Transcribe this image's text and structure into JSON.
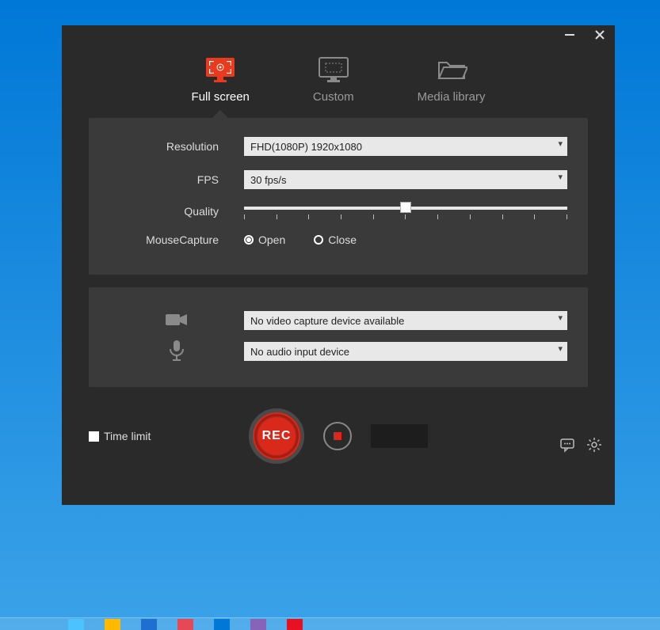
{
  "tabs": {
    "fullscreen": "Full screen",
    "custom": "Custom",
    "media": "Media library",
    "active_index": 0
  },
  "settings": {
    "resolution_label": "Resolution",
    "resolution_value": "FHD(1080P)   1920x1080",
    "fps_label": "FPS",
    "fps_value": "30 fps/s",
    "quality_label": "Quality",
    "quality_percent": 50,
    "mousecapture_label": "MouseCapture",
    "mousecapture_open": "Open",
    "mousecapture_close": "Close",
    "mousecapture_selected": "open"
  },
  "devices": {
    "video_value": "No video capture device available",
    "audio_value": "No audio input device"
  },
  "bottom": {
    "time_limit_label": "Time limit",
    "time_limit_checked": false,
    "rec_label": "REC"
  },
  "colors": {
    "accent": "#e83b1d",
    "bg_window": "#2a2a2a",
    "bg_panel": "#3a3a3a"
  }
}
